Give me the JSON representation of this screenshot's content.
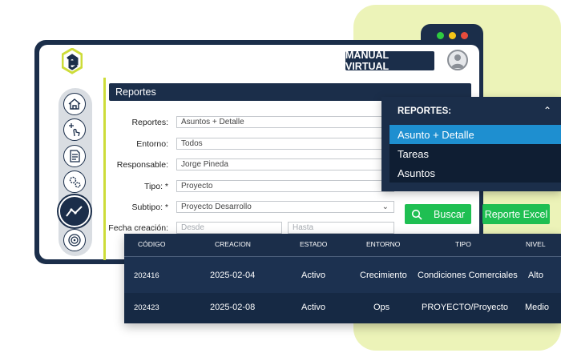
{
  "header": {
    "manual_label": "MANUAL VIRTUAL"
  },
  "icons": {
    "logo": "app-logo",
    "avatar": "user-avatar-icon",
    "sidebar": [
      "home-icon",
      "add-touch-icon",
      "document-icon",
      "gears-icon",
      "trend-chart-icon",
      "target-icon"
    ],
    "search": "search-icon"
  },
  "colors": {
    "navy": "#1b2e4a",
    "green": "#1fbf52",
    "lime": "#cddc39",
    "highlight": "#1e8fd0"
  },
  "section_title": "Reportes",
  "form": {
    "reportes": {
      "label": "Reportes:",
      "value": "Asuntos + Detalle"
    },
    "entorno": {
      "label": "Entorno:",
      "value": "Todos"
    },
    "responsable": {
      "label": "Responsable:",
      "value": "Jorge Pineda"
    },
    "tipo": {
      "label": "Tipo: *",
      "value": "Proyecto"
    },
    "subtipo": {
      "label": "Subtipo: *",
      "value": "Proyecto Desarrollo"
    },
    "fecha": {
      "label": "Fecha creación:",
      "desde_placeholder": "Desde",
      "hasta_placeholder": "Hasta"
    }
  },
  "dropdown": {
    "title": "REPORTES:",
    "items": [
      "Asunto + Detalle",
      "Tareas",
      "Asuntos"
    ],
    "selected": "Asunto + Detalle"
  },
  "buttons": {
    "buscar": "Buscar",
    "excel": "Reporte Excel"
  },
  "table": {
    "headers": [
      "CÓDIGO",
      "CREACION",
      "ESTADO",
      "ENTORNO",
      "TIPO",
      "NIVEL"
    ],
    "rows": [
      [
        "202416",
        "2025-02-04",
        "Activo",
        "Crecimiento",
        "Condiciones Comerciales",
        "Alto"
      ],
      [
        "202423",
        "2025-02-08",
        "Activo",
        "Ops",
        "PROYECTO/Proyecto",
        "Medio"
      ]
    ]
  }
}
